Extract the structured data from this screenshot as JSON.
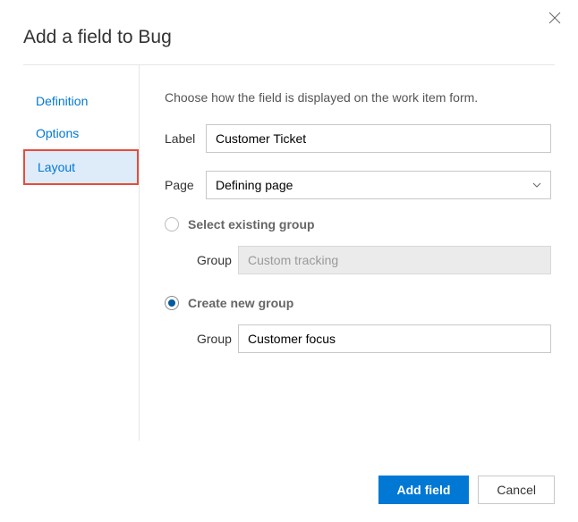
{
  "dialog": {
    "title": "Add a field to Bug"
  },
  "tabs": [
    {
      "label": "Definition",
      "selected": false
    },
    {
      "label": "Options",
      "selected": false
    },
    {
      "label": "Layout",
      "selected": true
    }
  ],
  "content": {
    "intro": "Choose how the field is displayed on the work item form.",
    "label": {
      "caption": "Label",
      "value": "Customer Ticket"
    },
    "page": {
      "caption": "Page",
      "value": "Defining page"
    },
    "existing": {
      "radio_label": "Select existing group",
      "selected": false,
      "group_caption": "Group",
      "group_value": "Custom tracking"
    },
    "create": {
      "radio_label": "Create new group",
      "selected": true,
      "group_caption": "Group",
      "group_value": "Customer focus"
    }
  },
  "footer": {
    "primary": "Add field",
    "secondary": "Cancel"
  }
}
